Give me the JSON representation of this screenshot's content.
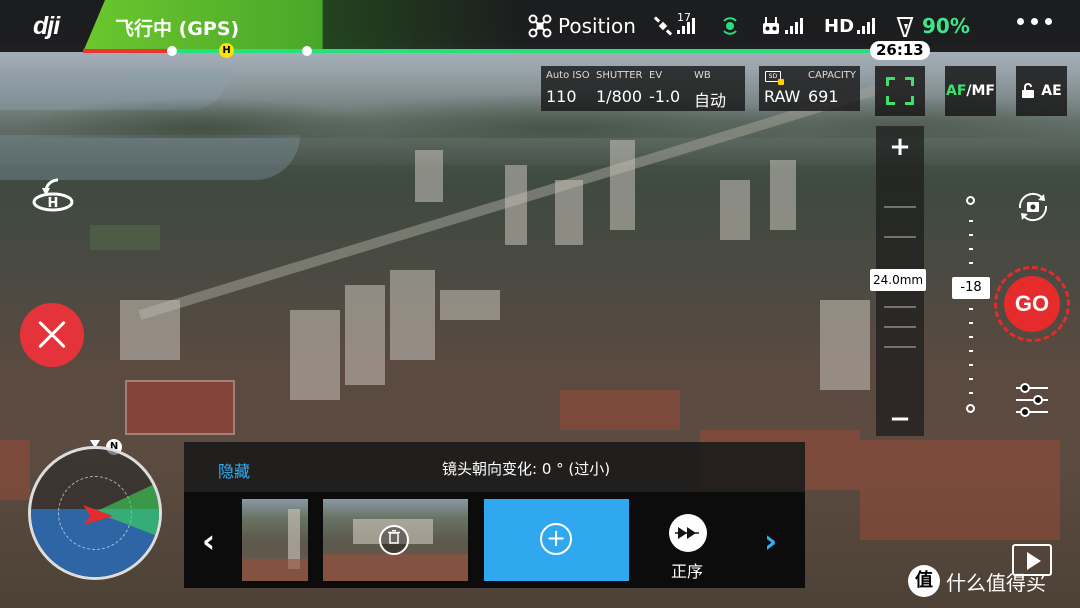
{
  "topbar": {
    "logo_text": "dji",
    "flight_status": "飞行中 (GPS)",
    "flight_mode": "Position",
    "gps_satellites": "17",
    "hd_label": "HD",
    "battery_percent": "90%",
    "time_remaining": "26:13",
    "home_marker": "H",
    "battery_remaining_fraction": 0.9
  },
  "camera": {
    "iso_key": "Auto ISO",
    "iso_value": "110",
    "shutter_key": "SHUTTER",
    "shutter_value": "1/800",
    "ev_key": "EV",
    "ev_value": "-1.0",
    "wb_key": "WB",
    "wb_value": "自动",
    "storage_icon": "sd-card-icon",
    "format_value": "RAW",
    "capacity_key": "CAPACITY",
    "capacity_value": "691",
    "focus_mode": "AF/MF",
    "focus_mode_af": "AF",
    "focus_mode_rest": "/MF",
    "exposure_lock": "AE"
  },
  "zoom": {
    "plus": "+",
    "minus": "−",
    "focal_length": "24.0mm"
  },
  "gimbal": {
    "pitch_value": "-18"
  },
  "go_button": "GO",
  "message": {
    "hide_label": "隐藏",
    "text": "镜头朝向变化: 0 ° (过小)"
  },
  "waypoints": {
    "prev": "‹",
    "next": "›",
    "order_label": "正序"
  },
  "compass": {
    "north_label": "N"
  },
  "watermark": {
    "badge": "值",
    "text": "什么值得买"
  },
  "colors": {
    "accent_green": "#26e07a",
    "status_green": "#6bc72c",
    "alert_red": "#e52b2b",
    "accent_blue": "#2fa8f0",
    "battery_text": "#3ee58a"
  }
}
